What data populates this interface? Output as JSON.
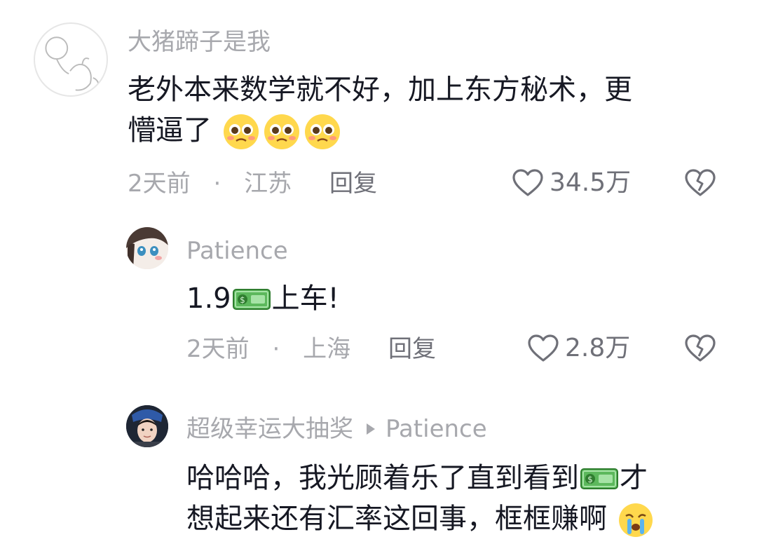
{
  "comments": [
    {
      "username": "大猪蹄子是我",
      "text_line1": "老外本来数学就不好，加上东方秘术，更",
      "text_line2": "懵逼了",
      "time": "2天前",
      "separator": "·",
      "location": "江苏",
      "reply_label": "回复",
      "likes": "34.5万"
    },
    {
      "username": "Patience",
      "text_before": "1.9",
      "text_after": "上车!",
      "time": "2天前",
      "separator": "·",
      "location": "上海",
      "reply_label": "回复",
      "likes": "2.8万"
    },
    {
      "username": "超级幸运大抽奖",
      "reply_to": "Patience",
      "text_line1": "哈哈哈，我光顾着乐了直到看到",
      "text_line1_after": "才",
      "text_line2": "想起来还有汇率这回事，框框赚啊"
    }
  ],
  "colors": {
    "text": "#161823",
    "secondary": "#a7a8ad",
    "action": "#6f7078"
  }
}
